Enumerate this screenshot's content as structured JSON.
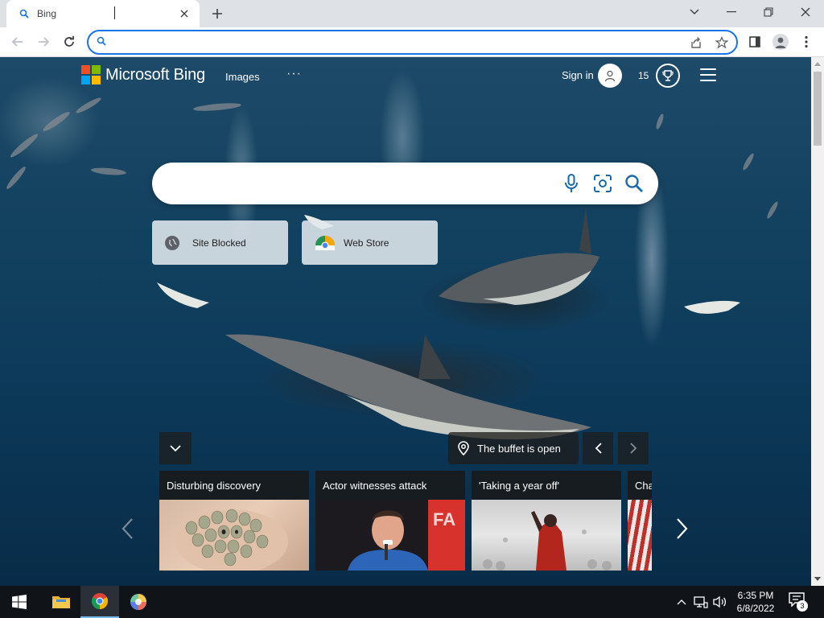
{
  "browser": {
    "tab_title": "Bing",
    "omnibox_value": "",
    "omnibox_placeholder": ""
  },
  "bing": {
    "brand": "Microsoft Bing",
    "nav_images": "Images",
    "nav_more": "···",
    "sign_in": "Sign in",
    "rewards_count": "15",
    "search_value": "",
    "quick_links": [
      {
        "label": "Site Blocked",
        "icon": "globe-icon"
      },
      {
        "label": "Web Store",
        "icon": "chrome-icon"
      }
    ],
    "image_location": "The buffet is open",
    "news_cards": [
      {
        "title": "Disturbing discovery"
      },
      {
        "title": "Actor witnesses attack"
      },
      {
        "title": "'Taking a year off'"
      },
      {
        "title": "Cha"
      }
    ]
  },
  "taskbar": {
    "time": "6:35 PM",
    "date": "6/8/2022",
    "notification_count": "3"
  },
  "colors": {
    "accent": "#1a73e8",
    "ms_red": "#f25022",
    "ms_green": "#7fba00",
    "ms_blue": "#00a4ef",
    "ms_yellow": "#ffb900"
  }
}
